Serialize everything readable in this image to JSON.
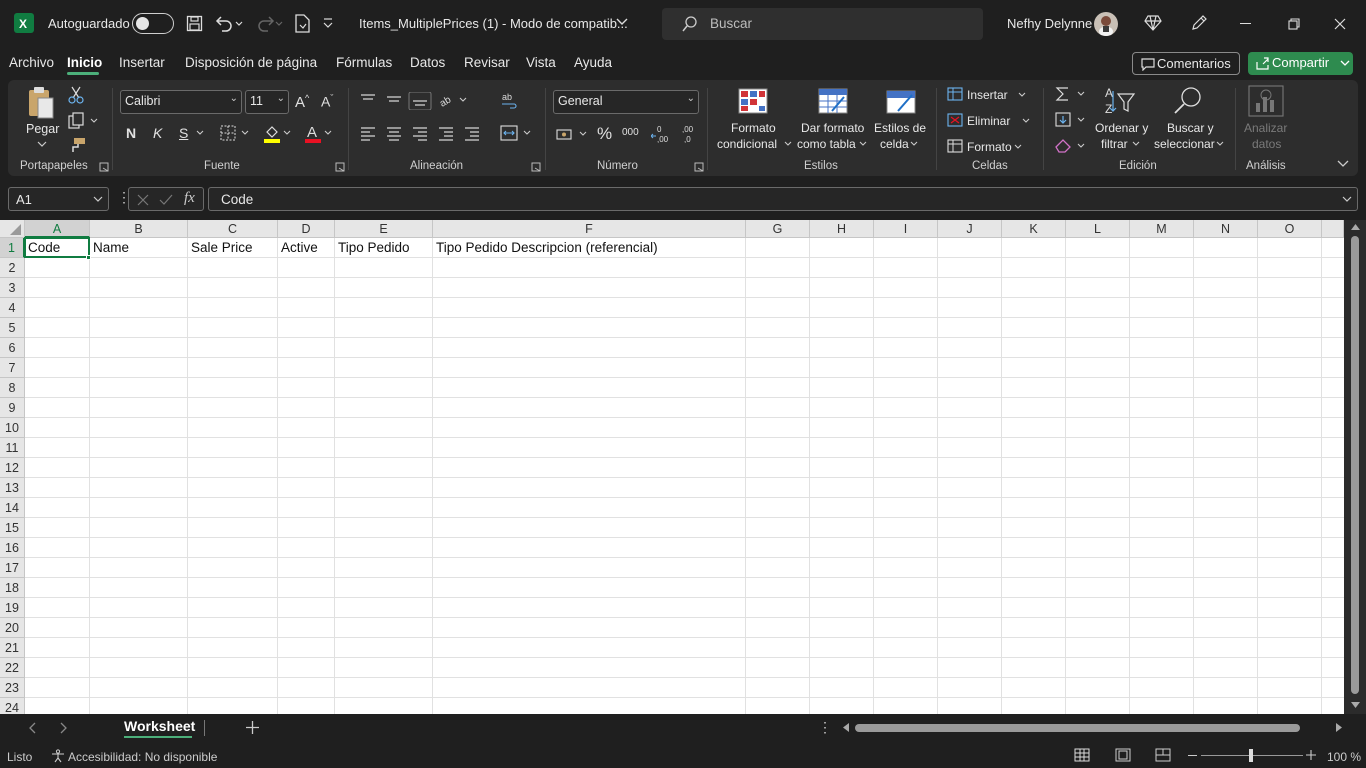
{
  "titlebar": {
    "autosave_label": "Autoguardado",
    "doc_title": "Items_MultiplePrices (1)  -  Modo de compatib...",
    "search_placeholder": "Buscar",
    "user_name": "Nefhy Delynne"
  },
  "menu": [
    "Archivo",
    "Inicio",
    "Insertar",
    "Disposición de página",
    "Fórmulas",
    "Datos",
    "Revisar",
    "Vista",
    "Ayuda"
  ],
  "menu_active": "Inicio",
  "actions": {
    "comments_label": "Comentarios",
    "share_label": "Compartir"
  },
  "ribbon": {
    "paste_label": "Pegar",
    "font_name": "Calibri",
    "font_size": "11",
    "bold": "N",
    "italic": "K",
    "underline": "S",
    "number_format": "General",
    "cond_format_l1": "Formato",
    "cond_format_l2": "condicional",
    "format_table_l1": "Dar formato",
    "format_table_l2": "como tabla",
    "cell_styles_l1": "Estilos de",
    "cell_styles_l2": "celda",
    "insert_label": "Insertar",
    "delete_label": "Eliminar",
    "format_label": "Formato",
    "sort_l1": "Ordenar y",
    "sort_l2": "filtrar",
    "find_l1": "Buscar y",
    "find_l2": "seleccionar",
    "analyze_l1": "Analizar",
    "analyze_l2": "datos",
    "groups": {
      "portapapeles": "Portapapeles",
      "fuente": "Fuente",
      "alineacion": "Alineación",
      "numero": "Número",
      "estilos": "Estilos",
      "celdas": "Celdas",
      "edicion": "Edición",
      "analisis": "Análisis"
    }
  },
  "formula": {
    "name_box": "A1",
    "content": "Code"
  },
  "grid": {
    "columns": [
      "A",
      "B",
      "C",
      "D",
      "E",
      "F",
      "G",
      "H",
      "I",
      "J",
      "K",
      "L",
      "M",
      "N",
      "O"
    ],
    "rows": [
      "1",
      "2",
      "3",
      "4",
      "5",
      "6",
      "7",
      "8",
      "9",
      "10",
      "11",
      "12",
      "13",
      "14",
      "15",
      "16",
      "17",
      "18",
      "19",
      "20",
      "21",
      "22",
      "23",
      "24"
    ],
    "row1": [
      "Code",
      "Name",
      "Sale Price",
      "Active",
      "Tipo Pedido",
      "Tipo Pedido Descripcion (referencial)"
    ],
    "selected_cell": "A1"
  },
  "sheets": {
    "active": "Worksheet"
  },
  "status": {
    "ready": "Listo",
    "accessibility": "Accesibilidad: No disponible",
    "zoom": "100 %"
  },
  "colors": {
    "accent_green": "#107c41",
    "share_green": "#2e8b4f"
  }
}
